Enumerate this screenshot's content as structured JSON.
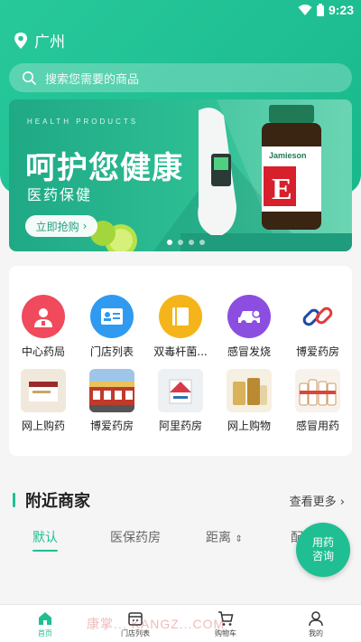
{
  "status_bar": {
    "time": "9:23",
    "icons": [
      "wifi-icon",
      "battery-icon"
    ]
  },
  "location": {
    "city": "广州",
    "icon": "location-pin-icon"
  },
  "search": {
    "placeholder": "搜索您需要的商品",
    "icon": "search-icon"
  },
  "banner": {
    "caption": "HEALTH PRODUCTS",
    "headline": "呵护您健康",
    "subtitle": "医药保健",
    "button_label": "立即抢购",
    "product_brand": "Jamieson",
    "product_letter": "E",
    "slide_count": 4,
    "active_slide": 1
  },
  "grid": {
    "row1": [
      {
        "label": "中心药局",
        "icon": "pharmacist-icon",
        "color": "#f04a5c"
      },
      {
        "label": "门店列表",
        "icon": "id-card-icon",
        "color": "#2f9af0"
      },
      {
        "label": "双毒杆菌...",
        "icon": "book-icon",
        "color": "#f6b41b"
      },
      {
        "label": "感冒发烧",
        "icon": "car-icon",
        "color": "#8b4ee0"
      },
      {
        "label": "博爱药房",
        "icon": "link-icon",
        "color": "#e23b3b"
      }
    ],
    "row2": [
      {
        "label": "网上购药",
        "icon": "product-box-image"
      },
      {
        "label": "博爱药房",
        "icon": "pharmacy-building-image"
      },
      {
        "label": "阿里药房",
        "icon": "medicine-box-image"
      },
      {
        "label": "网上购物",
        "icon": "supplement-bottles-image"
      },
      {
        "label": "感冒用药",
        "icon": "medicine-bottles-image"
      }
    ]
  },
  "nearby": {
    "title": "附近商家",
    "more": "查看更多",
    "tabs": [
      "默认",
      "医保药房",
      "距离",
      "配"
    ],
    "active_tab": 0
  },
  "fab": {
    "line1": "用药",
    "line2": "咨询"
  },
  "bottom_nav": [
    {
      "label": "首页",
      "icon": "home-icon",
      "active": true
    },
    {
      "label": "门店列表",
      "icon": "store-icon",
      "active": false
    },
    {
      "label": "购物车",
      "icon": "cart-icon",
      "active": false
    },
    {
      "label": "我的",
      "icon": "user-icon",
      "active": false
    }
  ],
  "watermark": "康掌... KANGZ...COM",
  "colors": {
    "brand": "#1fbf93",
    "background": "#f5f5f5"
  }
}
